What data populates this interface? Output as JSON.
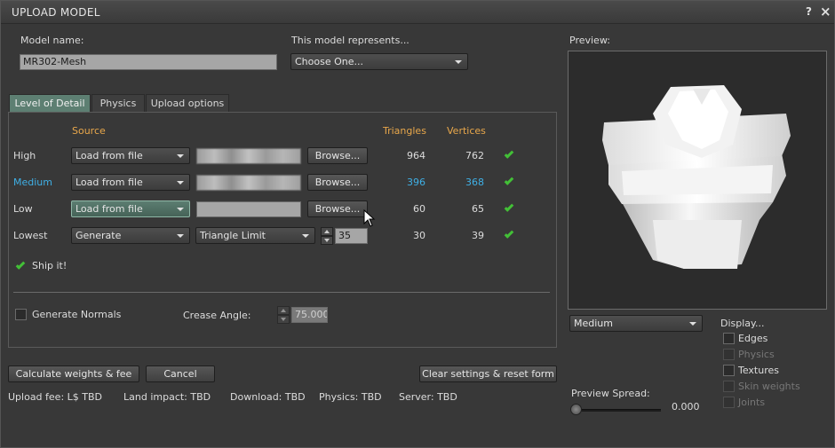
{
  "window": {
    "title": "UPLOAD MODEL",
    "help": "?",
    "close": "×"
  },
  "model": {
    "name_label": "Model name:",
    "name_value": "MR302-Mesh",
    "represents_label": "This model represents...",
    "represents_value": "Choose One..."
  },
  "tabs": [
    {
      "label": "Level of Detail",
      "active": true
    },
    {
      "label": "Physics",
      "active": false
    },
    {
      "label": "Upload options",
      "active": false
    }
  ],
  "lod": {
    "headers": {
      "source": "Source",
      "triangles": "Triangles",
      "vertices": "Vertices"
    },
    "rows": [
      {
        "name": "High",
        "source": "Load from file",
        "browse": "Browse...",
        "triangles": "964",
        "vertices": "762"
      },
      {
        "name": "Medium",
        "source": "Load from file",
        "browse": "Browse...",
        "triangles": "396",
        "vertices": "368"
      },
      {
        "name": "Low",
        "source": "Load from file",
        "browse": "Browse...",
        "triangles": "60",
        "vertices": "65"
      },
      {
        "name": "Lowest",
        "source": "Generate",
        "method": "Triangle Limit",
        "limit": "35",
        "triangles": "30",
        "vertices": "39"
      }
    ],
    "ship_it": "Ship it!"
  },
  "normals": {
    "generate_label": "Generate Normals",
    "crease_label": "Crease Angle:",
    "crease_value": "75.000"
  },
  "buttons": {
    "calculate": "Calculate weights & fee",
    "cancel": "Cancel",
    "clear": "Clear settings & reset form"
  },
  "status": {
    "upload_fee": "Upload fee: L$ TBD",
    "land_impact": "Land impact: TBD",
    "download": "Download: TBD",
    "physics": "Physics: TBD",
    "server": "Server: TBD"
  },
  "preview": {
    "label": "Preview:",
    "lod_select": "Medium",
    "display_label": "Display...",
    "display_options": [
      {
        "label": "Edges",
        "enabled": true
      },
      {
        "label": "Physics",
        "enabled": false
      },
      {
        "label": "Textures",
        "enabled": true
      },
      {
        "label": "Skin weights",
        "enabled": false
      },
      {
        "label": "Joints",
        "enabled": false
      }
    ],
    "spread_label": "Preview Spread:",
    "spread_value": "0.000"
  },
  "colors": {
    "accent": "#5d7f72",
    "orange": "#e8a74b",
    "blue": "#3fb0e6",
    "check": "#43c037"
  }
}
